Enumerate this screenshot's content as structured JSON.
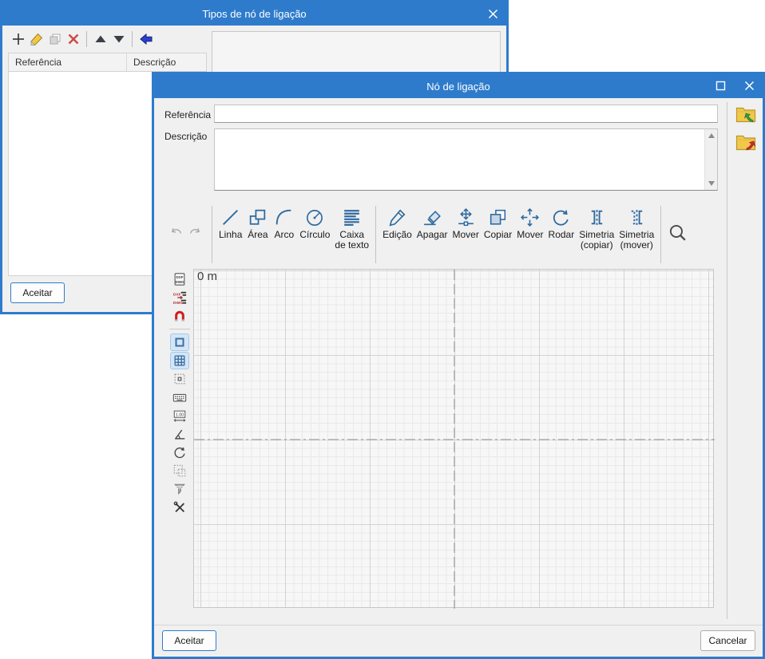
{
  "colors": {
    "accent": "#2e7bcc",
    "tool_icon_blue": "#2d6a9f",
    "delete_red": "#c0392b",
    "back_arrow_blue": "#2b3fd0",
    "magnet_red": "#cc2222",
    "folder_yellow": "#f2c84b",
    "canvas_bg": "#f7f7f7",
    "grid_minor": "#e9e9e9",
    "grid_major": "#d3d3d3",
    "crosshair": "#8f8f8f"
  },
  "back_dialog": {
    "title": "Tipos de nó de ligação",
    "close_icon": "close-icon",
    "toolbar": [
      "add",
      "edit",
      "duplicate",
      "delete",
      "|",
      "move-up",
      "move-down",
      "|",
      "back"
    ],
    "table_columns": [
      "Referência",
      "Descrição"
    ],
    "table_rows": [],
    "accept_label": "Aceitar"
  },
  "front_dialog": {
    "title": "Nó de ligação",
    "window_icons": [
      "maximize-icon",
      "close-icon"
    ],
    "reference_label": "Referência",
    "reference_value": "",
    "description_label": "Descrição",
    "description_value": "",
    "side_icons": [
      "import-folder-icon",
      "export-folder-icon"
    ],
    "history_icons": [
      "undo-icon",
      "redo-icon"
    ],
    "tools": [
      {
        "icon": "linha",
        "label": "Linha"
      },
      {
        "icon": "area",
        "label": "Área"
      },
      {
        "icon": "arco",
        "label": "Arco"
      },
      {
        "icon": "circulo",
        "label": "Círculo"
      },
      {
        "icon": "caixa-texto",
        "label": "Caixa",
        "label2": "de texto"
      },
      "|",
      {
        "icon": "edicao",
        "label": "Edição"
      },
      {
        "icon": "apagar",
        "label": "Apagar"
      },
      {
        "icon": "mover-no",
        "label": "Mover"
      },
      {
        "icon": "copiar",
        "label": "Copiar"
      },
      {
        "icon": "mover",
        "label": "Mover"
      },
      {
        "icon": "rodar",
        "label": "Rodar"
      },
      {
        "icon": "simetria-copiar",
        "label": "Simetria",
        "label2": "(copiar)"
      },
      {
        "icon": "simetria-mover",
        "label": "Simetria",
        "label2": "(mover)"
      }
    ],
    "search_icon": "magnifier-icon",
    "left_tools": [
      {
        "name": "dxf-dwg-file",
        "pressed": false
      },
      {
        "name": "dxf-dwg-layers",
        "pressed": false
      },
      {
        "name": "snap-magnet",
        "pressed": false
      },
      "|",
      {
        "name": "ortho-square",
        "pressed": true
      },
      {
        "name": "grid",
        "pressed": true
      },
      {
        "name": "snap-grid-points",
        "pressed": false
      },
      {
        "name": "keyboard-coords",
        "pressed": false
      },
      {
        "name": "dimension",
        "pressed": false
      },
      {
        "name": "angle",
        "pressed": false
      },
      {
        "name": "orbit",
        "pressed": false
      },
      {
        "name": "selection-window",
        "pressed": false
      },
      {
        "name": "filter",
        "pressed": false
      },
      {
        "name": "tools-config",
        "pressed": false
      }
    ],
    "canvas": {
      "origin_label": "0 m"
    },
    "accept_label": "Aceitar",
    "cancel_label": "Cancelar"
  }
}
